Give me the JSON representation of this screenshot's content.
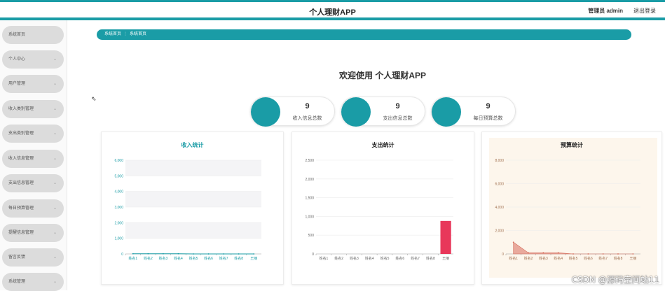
{
  "header": {
    "title": "个人理财APP",
    "user": "管理员 admin",
    "logout": "退出登录"
  },
  "sidebar": {
    "items": [
      {
        "label": "系统首页",
        "chev": ""
      },
      {
        "label": "个人中心",
        "chev": "⌄"
      },
      {
        "label": "用户管理",
        "chev": "⌄"
      },
      {
        "label": "收入类别管理",
        "chev": "⌄"
      },
      {
        "label": "支出类别管理",
        "chev": "⌄"
      },
      {
        "label": "收入信息管理",
        "chev": "⌄"
      },
      {
        "label": "支出信息管理",
        "chev": "⌄"
      },
      {
        "label": "每日预算管理",
        "chev": "⌄"
      },
      {
        "label": "提醒信息管理",
        "chev": "⌄"
      },
      {
        "label": "留言反馈",
        "chev": "⌄"
      },
      {
        "label": "系统管理",
        "chev": "⌄"
      }
    ]
  },
  "breadcrumb": {
    "root": "系统首页",
    "separator": "⋮",
    "current": "系统首页"
  },
  "welcome": "欢迎使用 个人理财APP",
  "stats": [
    {
      "value": "9",
      "label": "收入信息总数"
    },
    {
      "value": "9",
      "label": "支出信息总数"
    },
    {
      "value": "9",
      "label": "每日预算总数"
    }
  ],
  "colors": {
    "accent": "#1a9ca6",
    "expense_bar": "#e8375a",
    "budget_area": "#e0897a"
  },
  "watermark": "CSDN @源码空间站11",
  "chart_data": [
    {
      "type": "line",
      "title": "收入统计",
      "categories": [
        "姓名1",
        "姓名2",
        "姓名3",
        "姓名4",
        "姓名5",
        "姓名6",
        "姓名7",
        "姓名8",
        "王丽"
      ],
      "values": [
        10,
        10,
        10,
        10,
        0,
        0,
        0,
        0,
        0
      ],
      "yticks": [
        "0",
        "1,000",
        "2,000",
        "3,000",
        "4,000",
        "5,000",
        "6,000"
      ],
      "ylim": [
        0,
        6000
      ]
    },
    {
      "type": "bar",
      "title": "支出统计",
      "categories": [
        "姓名1",
        "姓名2",
        "姓名3",
        "姓名4",
        "姓名5",
        "姓名6",
        "姓名7",
        "姓名8",
        "王丽"
      ],
      "values": [
        0,
        0,
        0,
        0,
        0,
        0,
        0,
        0,
        880
      ],
      "yticks": [
        "0",
        "500",
        "1,000",
        "1,500",
        "2,000",
        "2,500"
      ],
      "ylim": [
        0,
        2500
      ]
    },
    {
      "type": "area",
      "title": "预算统计",
      "categories": [
        "姓名1",
        "姓名2",
        "姓名3",
        "姓名4",
        "姓名5",
        "姓名6",
        "姓名7",
        "姓名8",
        "王丽"
      ],
      "values": [
        1000,
        100,
        100,
        100,
        0,
        0,
        0,
        0,
        0
      ],
      "yticks": [
        "0",
        "2,000",
        "4,000",
        "6,000",
        "8,000"
      ],
      "ylim": [
        0,
        8000
      ]
    }
  ]
}
